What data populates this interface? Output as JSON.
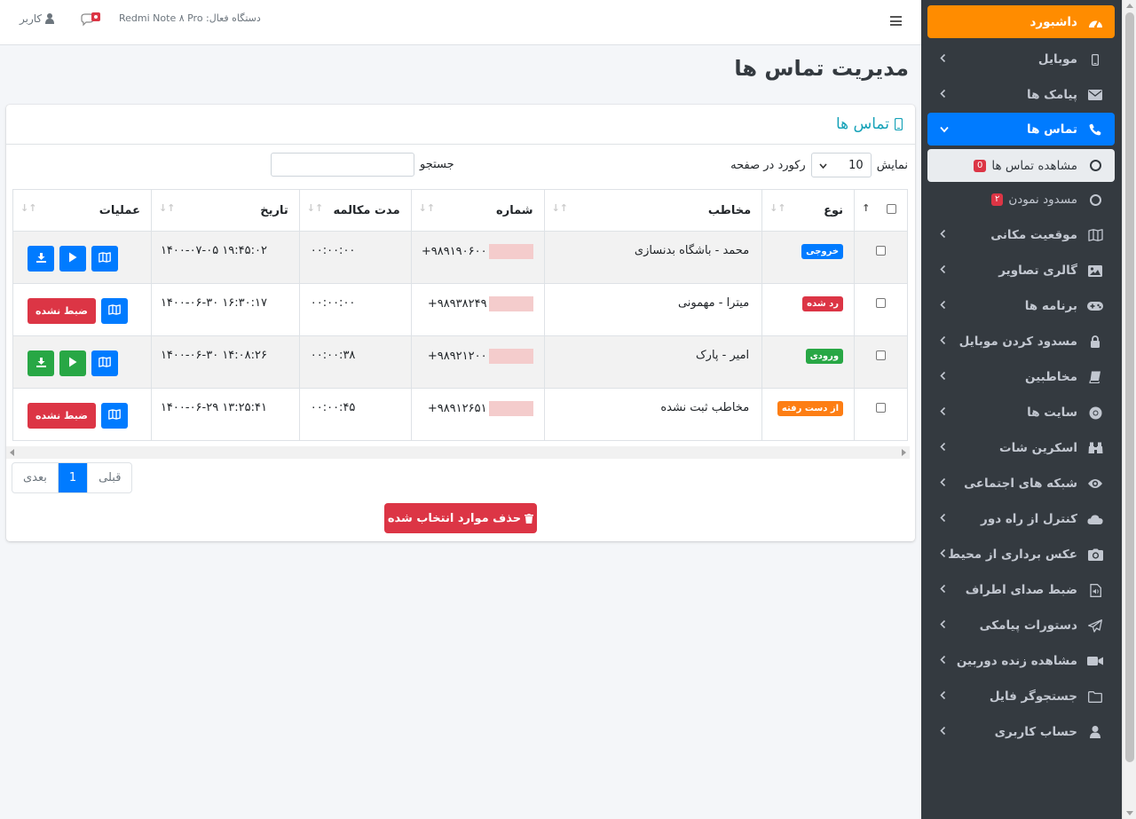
{
  "topbar": {
    "device_label": "دستگاه فعال: Redmi Note ۸ Pro",
    "user_label": "کاربر",
    "chat_badge": "0"
  },
  "sidebar": {
    "items": [
      {
        "label": "داشبورد",
        "icon": "dashboard-icon"
      },
      {
        "label": "موبایل",
        "icon": "mobile-icon"
      },
      {
        "label": "پیامک ها",
        "icon": "envelope-icon"
      },
      {
        "label": "تماس ها",
        "icon": "phone-icon"
      },
      {
        "label": "مشاهده تماس ها",
        "badge": "0"
      },
      {
        "label": "مسدود نمودن",
        "badge": "۲"
      },
      {
        "label": "موقعیت مکانی",
        "icon": "map-icon"
      },
      {
        "label": "گالری تصاویر",
        "icon": "image-icon"
      },
      {
        "label": "برنامه ها",
        "icon": "gamepad-icon"
      },
      {
        "label": "مسدود کردن موبایل",
        "icon": "lock-icon"
      },
      {
        "label": "مخاطبین",
        "icon": "book-icon"
      },
      {
        "label": "سایت ها",
        "icon": "chrome-icon"
      },
      {
        "label": "اسکرین شات",
        "icon": "binoculars-icon"
      },
      {
        "label": "شبکه های اجتماعی",
        "icon": "eye-icon"
      },
      {
        "label": "کنترل از راه دور",
        "icon": "cloud-icon"
      },
      {
        "label": "عکس برداری از محیط",
        "icon": "camera-icon"
      },
      {
        "label": "ضبط صدای اطراف",
        "icon": "audio-file-icon"
      },
      {
        "label": "دستورات پیامکی",
        "icon": "send-icon"
      },
      {
        "label": "مشاهده زنده دوربین",
        "icon": "video-icon"
      },
      {
        "label": "جستجوگر فایل",
        "icon": "folder-icon"
      },
      {
        "label": "حساب کاربری",
        "icon": "user-icon"
      }
    ]
  },
  "page": {
    "title": "مدیریت تماس ها",
    "card_title": "تماس ها"
  },
  "controls": {
    "show_label": "نمایش",
    "page_size": "10",
    "records_label": "رکورد در صفحه",
    "search_label": "جستجو"
  },
  "table": {
    "headers": [
      "نوع",
      "مخاطب",
      "شماره",
      "مدت مکالمه",
      "تاریخ",
      "عملیات"
    ],
    "rows": [
      {
        "type": "خروجی",
        "type_color": "#007bff",
        "contact": "محمد -  باشگاه بدنسازی",
        "number": "+۹۸۹۱۹۰۶۰۰",
        "duration": "۰۰:۰۰:۰۰",
        "date": "۱۴۰۰-۰۷-۰۵ ۱۹:۴۵:۰۲",
        "recorded": true,
        "download_color": "#007bff"
      },
      {
        "type": "رد شده",
        "type_color": "#dc3545",
        "contact": "میترا - مهمونی",
        "number": "+۹۸۹۳۸۲۴۹",
        "duration": "۰۰:۰۰:۰۰",
        "date": "۱۴۰۰-۰۶-۳۰ ۱۶:۳۰:۱۷",
        "recorded": false,
        "no_record_label": "ضبط نشده"
      },
      {
        "type": "ورودی",
        "type_color": "#28a745",
        "contact": "امیر - پارک",
        "number": "+۹۸۹۲۱۲۰۰",
        "duration": "۰۰:۰۰:۳۸",
        "date": "۱۴۰۰-۰۶-۳۰ ۱۴:۰۸:۲۶",
        "recorded": true,
        "download_color": "#28a745"
      },
      {
        "type": "از دست رفته",
        "type_color": "#fd7e14",
        "contact": "مخاطب ثبت نشده",
        "number": "+۹۸۹۱۲۶۵۱",
        "duration": "۰۰:۰۰:۴۵",
        "date": "۱۴۰۰-۰۶-۲۹ ۱۳:۲۵:۴۱",
        "recorded": false,
        "no_record_label": "ضبط نشده"
      }
    ]
  },
  "pager": {
    "prev": "قبلی",
    "current": "1",
    "next": "بعدی"
  },
  "delete_button": "حذف موارد انتخاب شده"
}
